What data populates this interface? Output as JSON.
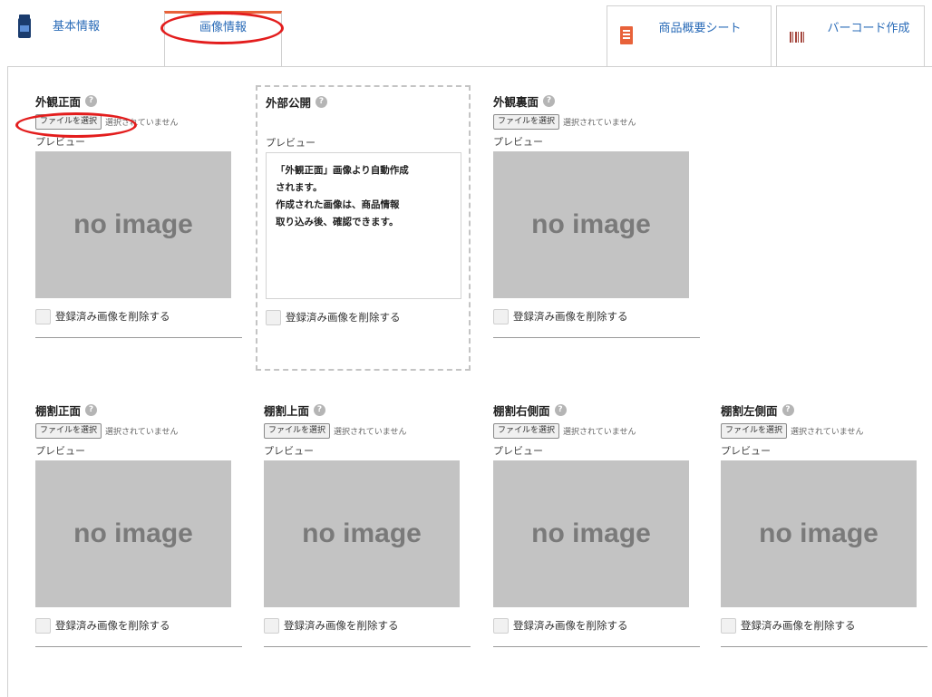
{
  "tabs": {
    "basic": "基本情報",
    "image": "画像情報",
    "summary": "商品概要シート",
    "barcode": "バーコード作成"
  },
  "common": {
    "file_button": "ファイルを選択",
    "file_status": "選択されていません",
    "preview_label": "プレビュー",
    "no_image": "no image",
    "delete_label": "登録済み画像を削除する",
    "help": "?"
  },
  "slots": {
    "front": {
      "title": "外観正面"
    },
    "public": {
      "title": "外部公開",
      "preview_lines": [
        "「外観正面」画像より自動作成",
        "されます。",
        "作成された画像は、商品情報",
        "取り込み後、確認できます。"
      ]
    },
    "back": {
      "title": "外観裏面"
    },
    "shelf_front": {
      "title": "棚割正面"
    },
    "shelf_top": {
      "title": "棚割上面"
    },
    "shelf_right": {
      "title": "棚割右側面"
    },
    "shelf_left": {
      "title": "棚割左側面"
    }
  },
  "colors": {
    "accent_tab": "#e8623a",
    "annotation_red": "#e31d1d",
    "link": "#2b6cb8"
  }
}
